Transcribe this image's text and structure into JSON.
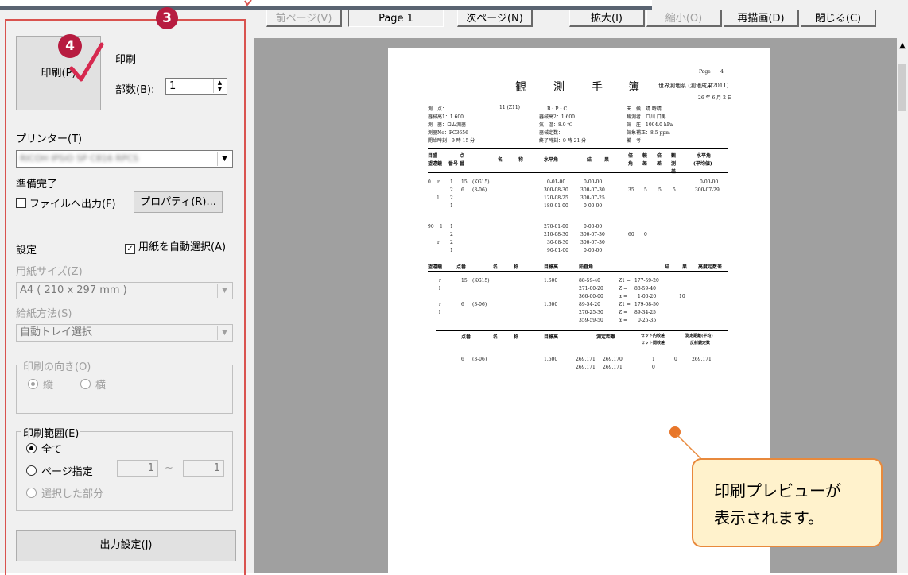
{
  "steps": {
    "three": "3",
    "four": "4"
  },
  "print_panel": {
    "print_button_label": "印刷(P)",
    "print_heading": "印刷",
    "copies_label": "部数(B):",
    "copies_value": "1",
    "printer_label": "プリンター(T)",
    "printer_value": "RICOH IPSiO SP C816 RPCS",
    "status": "準備完了",
    "print_to_file": "ファイルへ出力(F)",
    "properties_button": "プロパティ(R)...",
    "settings_label": "設定",
    "auto_select_paper": "用紙を自動選択(A)",
    "paper_size_label": "用紙サイズ(Z)",
    "paper_size_value": "A4 ( 210 x 297 mm )",
    "feed_label": "給紙方法(S)",
    "feed_value": "自動トレイ選択",
    "orientation_label": "印刷の向き(O)",
    "orientation_portrait": "縦",
    "orientation_landscape": "横",
    "range_label": "印刷範囲(E)",
    "range_all": "全て",
    "range_pages": "ページ指定",
    "range_from": "1",
    "range_tilde": "~",
    "range_to": "1",
    "range_selection": "選択した部分",
    "output_settings_button": "出力設定(J)"
  },
  "toolbar": {
    "prev_page": "前ページ(V)",
    "page_indicator": "Page 1",
    "next_page": "次ページ(N)",
    "zoom_in": "拡大(I)",
    "zoom_out": "縮小(O)",
    "redraw": "再描画(D)",
    "close": "閉じる(C)"
  },
  "document": {
    "page_label": "Page",
    "page_number": "4",
    "title": [
      "観",
      "測",
      "手",
      "簿"
    ],
    "system": "世界測地系 (測地成果2011)",
    "date": "26 年 6 月 2 日",
    "header_lines": [
      [
        "測　点：",
        "11 (Z11)",
        "B・P・C",
        "天　候：晴 時晴"
      ],
      [
        "器械高1：1.600",
        "器械高2：1.600",
        "観測者：ロ川 口男"
      ],
      [
        "測　器：ロム測器",
        "気　温：8.0 ℃",
        "気　圧：1004.0 hPa"
      ],
      [
        "測器No：FC3656",
        "器械定数：",
        "気象補正：8.5 ppm"
      ],
      [
        "開始時刻：9 時 15 分",
        "終了時刻：9 時 21 分",
        "備　考："
      ]
    ],
    "angle_header": [
      "目盛",
      "望遠鏡",
      "番号",
      "点",
      "番",
      "名",
      "称",
      "水平角",
      "結",
      "果",
      "倍",
      "角",
      "較",
      "差",
      "倍",
      "差",
      "観",
      "測",
      "差",
      "水平角",
      "(平均値)"
    ],
    "angle_rows": [
      [
        "0",
        "r",
        "1",
        "15",
        "(KG15)",
        "0-01-00",
        "0-00-00",
        "",
        "",
        "",
        "0-00-00"
      ],
      [
        "",
        "",
        "2",
        "6",
        "(3-06)",
        "300-08-30",
        "300-07-30",
        "35",
        "5",
        "5",
        "5",
        "300-07-29"
      ],
      [
        "",
        "l",
        "2",
        "",
        "",
        "120-08-25",
        "300-07-25"
      ],
      [
        "",
        "",
        "1",
        "",
        "",
        "180-01-00",
        "0-00-00"
      ],
      [
        "90",
        "l",
        "1",
        "",
        "",
        "270-01-00",
        "0-00-00"
      ],
      [
        "",
        "",
        "2",
        "",
        "",
        "210-08-30",
        "300-07-30",
        "60",
        "0"
      ],
      [
        "",
        "r",
        "2",
        "",
        "",
        "30-08-30",
        "300-07-30"
      ],
      [
        "",
        "",
        "1",
        "",
        "",
        "90-01-00",
        "0-00-00"
      ]
    ],
    "vertical_header": [
      "望遠鏡",
      "点番",
      "名",
      "称",
      "目標高",
      "鉛直角",
      "結",
      "果",
      "高度定数差"
    ],
    "vertical_rows": [
      [
        "r",
        "15",
        "(KG15)",
        "1.600",
        "88-59-40",
        "Z1 =",
        "177-59-20"
      ],
      [
        "l",
        "",
        "",
        "",
        "271-00-20",
        "Z =",
        "88-59-40"
      ],
      [
        "",
        "",
        "",
        "",
        "360-00-00",
        "α =",
        "1-00-20",
        "10"
      ],
      [
        "r",
        "6",
        "(3-06)",
        "1.600",
        "89-54-20",
        "Z1 =",
        "179-08-50"
      ],
      [
        "l",
        "",
        "",
        "",
        "270-25-30",
        "Z =",
        "89-34-25"
      ],
      [
        "",
        "",
        "",
        "",
        "359-59-50",
        "α =",
        "0-25-35"
      ]
    ],
    "distance_header": [
      "点番",
      "名",
      "称",
      "目標高",
      "測定距離",
      "セット内較差",
      "セット間較差",
      "測定距離(平均)",
      "反射鏡定数"
    ],
    "distance_rows": [
      [
        "6",
        "(3-06)",
        "1.600",
        "269.171",
        "269.170",
        "1",
        "0",
        "269.171"
      ],
      [
        "",
        "",
        "",
        "269.171",
        "269.171",
        "0"
      ]
    ]
  },
  "callout": {
    "line1": "印刷プレビューが",
    "line2": "表示されます。"
  }
}
